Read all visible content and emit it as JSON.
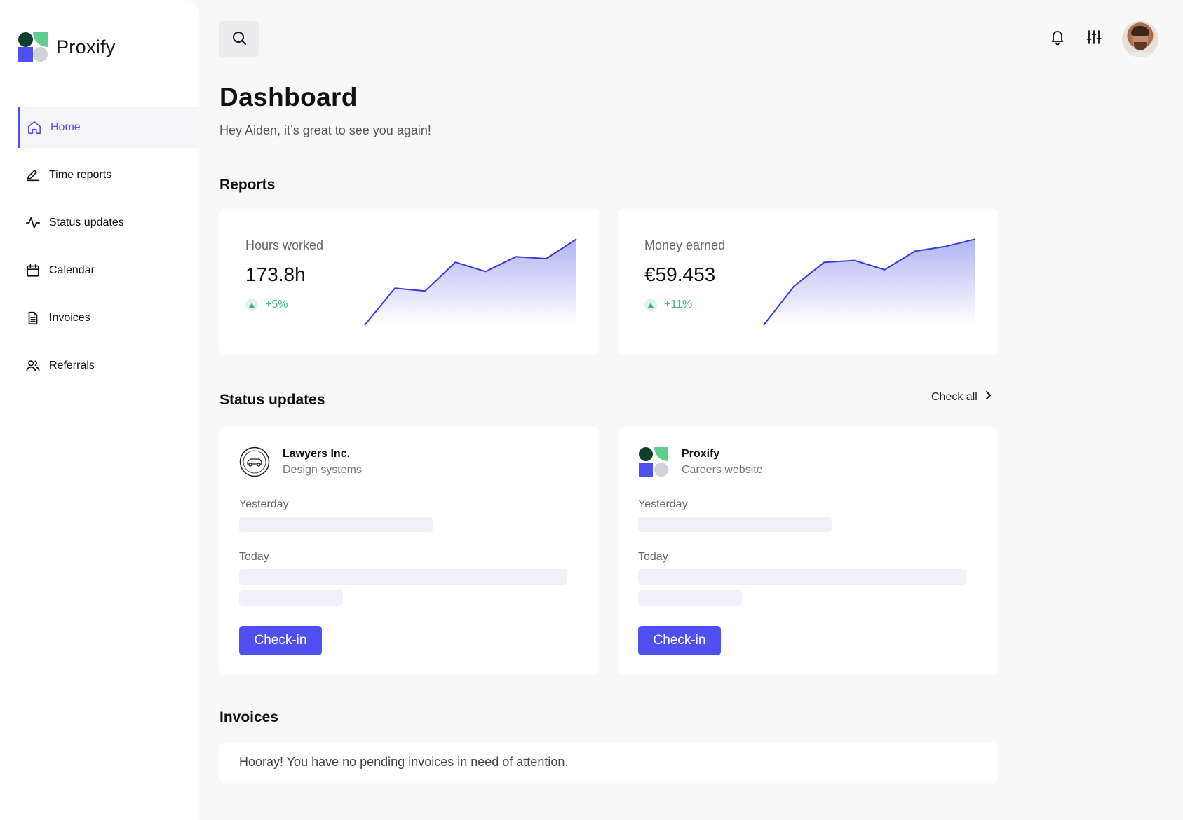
{
  "brand": {
    "name": "Proxify",
    "colors": {
      "green_dark": "#0f3d2e",
      "green_light": "#5ccf8f",
      "blue": "#5050f2",
      "gray": "#cfd2da"
    }
  },
  "sidebar": {
    "items": [
      {
        "label": "Home",
        "icon": "home-icon",
        "active": true
      },
      {
        "label": "Time reports",
        "icon": "pencil-icon",
        "active": false
      },
      {
        "label": "Status updates",
        "icon": "activity-icon",
        "active": false
      },
      {
        "label": "Calendar",
        "icon": "calendar-icon",
        "active": false
      },
      {
        "label": "Invoices",
        "icon": "document-icon",
        "active": false
      },
      {
        "label": "Referrals",
        "icon": "users-icon",
        "active": false
      }
    ]
  },
  "topbar": {
    "search_icon": "search-icon",
    "notifications_icon": "bell-icon",
    "settings_icon": "sliders-icon",
    "avatar": "user-avatar"
  },
  "page": {
    "title": "Dashboard",
    "subtitle": "Hey Aiden, it’s great to see you again!"
  },
  "reports": {
    "title": "Reports",
    "cards": [
      {
        "label": "Hours worked",
        "value": "173.8h",
        "delta": "+5%"
      },
      {
        "label": "Money earned",
        "value": "€59.453",
        "delta": "+11%"
      }
    ]
  },
  "chart_data": [
    {
      "type": "area",
      "x": [
        0,
        1,
        2,
        3,
        4,
        5,
        6,
        7
      ],
      "series": [
        {
          "values": [
            0,
            40,
            37,
            68,
            58,
            74,
            72,
            93
          ]
        }
      ],
      "ylim": [
        0,
        100
      ],
      "color": "#3a3adf",
      "fill": "#a9acf4"
    },
    {
      "type": "area",
      "x": [
        0,
        1,
        2,
        3,
        4,
        5,
        6,
        7
      ],
      "series": [
        {
          "values": [
            0,
            42,
            68,
            70,
            60,
            80,
            85,
            93
          ]
        }
      ],
      "ylim": [
        0,
        100
      ],
      "color": "#3a3adf",
      "fill": "#a9acf4"
    }
  ],
  "status_updates": {
    "title": "Status updates",
    "check_all": "Check all",
    "cards": [
      {
        "company": "Lawyers Inc.",
        "project": "Design systems",
        "yesterday": "Yesterday",
        "today": "Today",
        "button": "Check-in",
        "logo": "lawyers-logo"
      },
      {
        "company": "Proxify",
        "project": "Careers website",
        "yesterday": "Yesterday",
        "today": "Today",
        "button": "Check-in",
        "logo": "proxify-logo"
      }
    ]
  },
  "invoices": {
    "title": "Invoices",
    "message": "Hooray! You have no pending invoices in need of attention."
  }
}
